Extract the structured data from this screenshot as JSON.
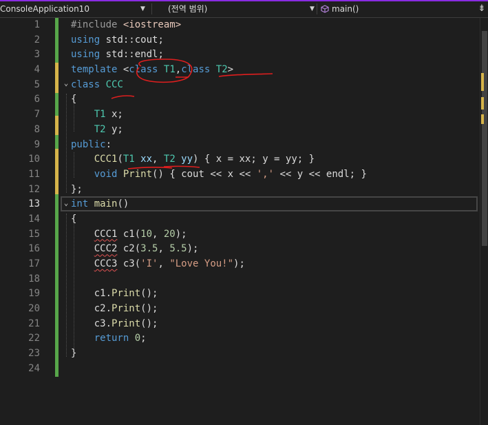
{
  "navbar": {
    "project": "ConsoleApplication10",
    "scope": "(전역 범위)",
    "member": "main()"
  },
  "editor": {
    "current_line": 13,
    "line_numbers": [
      "1",
      "2",
      "3",
      "4",
      "5",
      "6",
      "7",
      "8",
      "9",
      "10",
      "11",
      "12",
      "13",
      "14",
      "15",
      "16",
      "17",
      "18",
      "19",
      "20",
      "21",
      "22",
      "23",
      "24"
    ],
    "colors": {
      "keyword": "#569cd6",
      "type": "#4ec9b0",
      "function": "#dcdcaa",
      "string": "#d69d85",
      "number": "#b5cea8",
      "variable": "#9cdcfe",
      "change_saved": "#57a64a",
      "change_unsaved": "#d6b44a",
      "error_squiggle": "#e05252",
      "annotation_ink": "#e01e1e"
    },
    "code": {
      "l1": {
        "pp": "#include ",
        "inc": "<iostream>"
      },
      "l2": {
        "kw": "using",
        "rest": " std::cout;"
      },
      "l3": {
        "kw": "using",
        "rest": " std::endl;"
      },
      "l4": {
        "kw1": "template",
        "lt": " <",
        "kw2": "class",
        "t1": "T1",
        "comma": ",",
        "kw3": "class",
        "t2": "T2",
        "gt": ">"
      },
      "l5": {
        "kw": "class",
        "name": "CCC"
      },
      "l6": {
        "text": "{"
      },
      "l7": {
        "type": "T1",
        "rest": " x;"
      },
      "l8": {
        "type": "T2",
        "rest": " y;"
      },
      "l9": {
        "kw": "public",
        "rest": ":"
      },
      "l10": {
        "fn": "CCC1",
        "p1": "(",
        "t1": "T1",
        "xx": " xx",
        "c": ", ",
        "t2": "T2",
        "yy": " yy",
        "rest": ") { x = xx; y = yy; }"
      },
      "l11": {
        "kw": "void",
        "fn": "Print",
        "rest1": "() { cout << x << ",
        "str": "','",
        "rest2": " << y << endl; }"
      },
      "l12": {
        "text": "};"
      },
      "l13": {
        "kw": "int",
        "fn": "main",
        "rest": "()"
      },
      "l14": {
        "text": "{"
      },
      "l15": {
        "err": "CCC1",
        "rest1": " c1(",
        "n1": "10",
        "c": ", ",
        "n2": "20",
        "rest2": ");"
      },
      "l16": {
        "err": "CCC2",
        "rest1": " c2(",
        "n1": "3.5",
        "c": ", ",
        "n2": "5.5",
        "rest2": ");"
      },
      "l17": {
        "err": "CCC3",
        "rest1": " c3(",
        "s1": "'I'",
        "c": ", ",
        "s2": "\"Love You!\"",
        "rest2": ");"
      },
      "l18": {
        "text": ""
      },
      "l19": {
        "obj": "c1",
        "dot": ".",
        "fn": "Print",
        "rest": "();"
      },
      "l20": {
        "obj": "c2",
        "dot": ".",
        "fn": "Print",
        "rest": "();"
      },
      "l21": {
        "obj": "c3",
        "dot": ".",
        "fn": "Print",
        "rest": "();"
      },
      "l22": {
        "kw": "return",
        "sp": " ",
        "num": "0",
        "rest": ";"
      },
      "l23": {
        "text": "}"
      },
      "l24": {
        "text": ""
      }
    }
  }
}
